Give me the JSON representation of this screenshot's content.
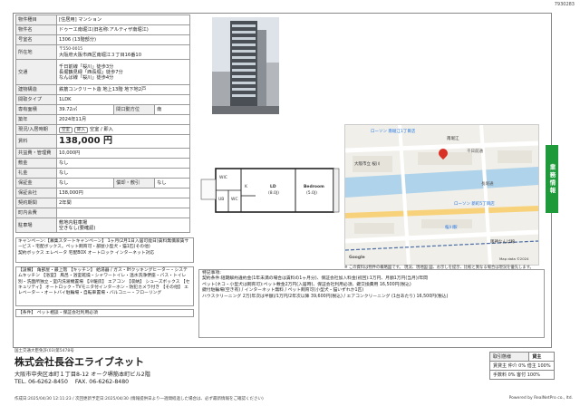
{
  "top_id": "7930283",
  "spec": {
    "rows": [
      {
        "key": "物件種目",
        "value": "[住居用] マンション"
      },
      {
        "key": "物件名",
        "value": "ドゥーエ南堀江(旧名称:アルティザ南堀江)"
      },
      {
        "key": "号室名",
        "value": "1306 (13階部分)"
      },
      {
        "key": "所在地",
        "zip": "〒550-0015",
        "value": "大阪府大阪市西区南堀江３丁目16番10"
      },
      {
        "key": "交通",
        "lines": [
          "千日前線「桜川」徒歩3分",
          "長堀鶴見緑「西長堀」徒歩7分",
          "なんば線「桜川」徒歩4分"
        ]
      },
      {
        "key": "建物構造",
        "value": "鉄筋コンクリート造 地上13階 地下地2戸"
      },
      {
        "key": "間取タイプ",
        "value": "1LDK"
      },
      {
        "key": "専有面積",
        "value": "39.72㎡",
        "extra_label": "間口動方位",
        "extra_value": "南"
      },
      {
        "key": "築年",
        "value": "2024年11月"
      },
      {
        "key": "現況/入居時期",
        "value": "空室 / 即入"
      },
      {
        "key": "賃料",
        "value": "138,000 円"
      },
      {
        "key": "共益費・管理費",
        "value": "10,000円"
      },
      {
        "key": "敷金",
        "value": "なし"
      },
      {
        "key": "礼金",
        "value": "なし"
      },
      {
        "key": "保証金",
        "value": "なし",
        "extra_label": "償却・敷引",
        "extra_value": "なし"
      },
      {
        "key": "保証会社",
        "value": "138,000円"
      },
      {
        "key": "契約期間",
        "value": "2年間"
      },
      {
        "key": "町内会費",
        "value": ""
      },
      {
        "key": "駐車場",
        "lines": [
          "敷地内駐車場",
          "空きなし(要確認)"
        ]
      }
    ]
  },
  "status_pills": [
    "空室",
    "即入"
  ],
  "notes": {
    "campaign": "キャンペーン:【募集スタートキャンペーン】 1ヶ月(2月1日入居可能日)賃料無償家賃サービス・宅配ボックス。ペット飼育可・部屋小型犬・猫1匹(その他)",
    "campaign_tail": "契約ボックス エレベータ 宅配BOX オートロック インターネット対応",
    "equipment": "【設備】 角部屋・最上階 【キッチン】 給湯器 / ガス・IHクッキングヒーター・システムキッチン 【浴室】 風呂・浴室乾燥・シャワートイレ・温水洗浄便座・バス・トイレ別・洗面所独立・室内洗濯機置場 【冷暖房】 エアコン 【収納】 シューズボックス 【セキュリティ】 オートロック・TVモニタ付インターホン・防犯カメラ付き 【その他】 エレベーター・オートバイ駐輪場・自転車置場・バルコニー・フローリング",
    "conditions": "【条件】 ペット相談・保証会社利用必須"
  },
  "floorplan": {
    "rooms": [
      "LD",
      "Bedroom",
      "WIC",
      "K",
      "UB",
      "WC"
    ],
    "ld_size": "(8.0J)",
    "bed_size": "(5.0J)"
  },
  "map": {
    "labels": [
      "ローソン 南堀江1丁目店",
      "南堀江",
      "千日前通",
      "大阪市立 桜川",
      "長堀通",
      "ローソン 新町5丁目店",
      "桜川駅",
      "阪神なんば線",
      "Map data ©2024",
      "Google"
    ],
    "pin_color": "#d93025"
  },
  "disclaimer": "※ この資料は物件の概略図です。 現況、現地図 図、お示しを提示、比較と異なる場合は現況を優先します。",
  "memo": {
    "title": "特記事項:",
    "lines": [
      "契約条件:短期解約違約金(1年未満の場合は賃料の1ヶ月分)、保証会社加入料金(初回):1万円、月額1万円(当月)/年間",
      "ペット(ネコ・小型犬は飼育可):ペット敷金2万円(入居時)、保証会社利用必須、鍵交換費用 16,500円(税込)",
      "鍵付駐輪場(空き有) / インターネット無料 / ペット飼育可(小型犬・猫いずれか1匹)",
      "ハウスクリーニング 2万(年次は半額)/1万円/2年次以降 39,600円(税込) / エアコンクリーニング (1台あたり) 16,500円(税込)"
    ]
  },
  "side_tab": "業務情報",
  "company": {
    "license": "国土交通大臣免許(03)第5478号",
    "name": "株式会社長谷エライブネット",
    "address": "大阪市中央区本町１丁目8-12 オーク堺筋本町ビル2階",
    "tel": "TEL. 06-6262-8450",
    "fax": "FAX. 06-6262-8480"
  },
  "deal": {
    "kind_label": "取引態様",
    "kind_value": "貸主",
    "rows": [
      "賃貸主 仲介 0% 借主 100%",
      "手数料 0% 客付 100%"
    ]
  },
  "footer": {
    "created": "作成日:2025/04/30 12:11:23 / 次回更新予定日:2025/04/30 (情報提供日より一週間経過した場合は、必ず最新情報をご確認ください)",
    "powered": "Powered by RealNetPro co., ltd."
  },
  "colors": {
    "accent_green": "#1f9a3b",
    "map_water": "#aed3ea",
    "map_road": "#f8d27a"
  }
}
